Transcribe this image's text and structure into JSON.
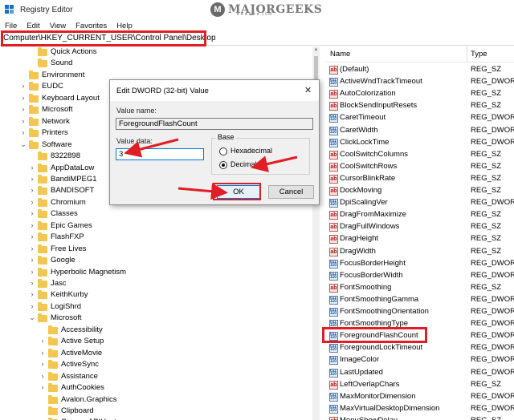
{
  "window": {
    "title": "Registry Editor"
  },
  "watermark": {
    "logo": "M",
    "text": "MAJORGEEKS",
    "suffix": ".COM",
    "stars": "★★★★★★.COM"
  },
  "menu": [
    "File",
    "Edit",
    "View",
    "Favorites",
    "Help"
  ],
  "address": "Computer\\HKEY_CURRENT_USER\\Control Panel\\Desktop",
  "tree": [
    {
      "label": "Quick Actions",
      "expander": "",
      "level": 3
    },
    {
      "label": "Sound",
      "expander": "",
      "level": 3
    },
    {
      "label": "Environment",
      "expander": "",
      "level": 2
    },
    {
      "label": "EUDC",
      "expander": "›",
      "level": 2
    },
    {
      "label": "Keyboard Layout",
      "expander": "›",
      "level": 2
    },
    {
      "label": "Microsoft",
      "expander": "›",
      "level": 2
    },
    {
      "label": "Network",
      "expander": "›",
      "level": 2
    },
    {
      "label": "Printers",
      "expander": "›",
      "level": 2
    },
    {
      "label": "Software",
      "expander": "⌄",
      "level": 2
    },
    {
      "label": "8322898",
      "expander": "",
      "level": 3
    },
    {
      "label": "AppDataLow",
      "expander": "›",
      "level": 3
    },
    {
      "label": "BandiMPEG1",
      "expander": "›",
      "level": 3
    },
    {
      "label": "BANDISOFT",
      "expander": "›",
      "level": 3
    },
    {
      "label": "Chromium",
      "expander": "›",
      "level": 3
    },
    {
      "label": "Classes",
      "expander": "›",
      "level": 3
    },
    {
      "label": "Epic Games",
      "expander": "›",
      "level": 3
    },
    {
      "label": "FlashFXP",
      "expander": "›",
      "level": 3
    },
    {
      "label": "Free Lives",
      "expander": "›",
      "level": 3
    },
    {
      "label": "Google",
      "expander": "›",
      "level": 3
    },
    {
      "label": "Hyperbolic Magnetism",
      "expander": "›",
      "level": 3
    },
    {
      "label": "Jasc",
      "expander": "›",
      "level": 3
    },
    {
      "label": "KeithKurby",
      "expander": "›",
      "level": 3
    },
    {
      "label": "LogiShrd",
      "expander": "›",
      "level": 3
    },
    {
      "label": "Microsoft",
      "expander": "⌄",
      "level": 3
    },
    {
      "label": "Accessibility",
      "expander": "",
      "level": 4
    },
    {
      "label": "Active Setup",
      "expander": "›",
      "level": 4
    },
    {
      "label": "ActiveMovie",
      "expander": "›",
      "level": 4
    },
    {
      "label": "ActiveSync",
      "expander": "›",
      "level": 4
    },
    {
      "label": "Assistance",
      "expander": "›",
      "level": 4
    },
    {
      "label": "AuthCookies",
      "expander": "›",
      "level": 4
    },
    {
      "label": "Avalon.Graphics",
      "expander": "",
      "level": 4
    },
    {
      "label": "Clipboard",
      "expander": "",
      "level": 4
    },
    {
      "label": "CameraAPIHost",
      "expander": "",
      "level": 4
    }
  ],
  "list": {
    "col_name": "Name",
    "col_type": "Type",
    "rows": [
      {
        "name": "(Default)",
        "type": "REG_SZ",
        "icon": "ab"
      },
      {
        "name": "ActiveWndTrackTimeout",
        "type": "REG_DWORD",
        "icon": "bin"
      },
      {
        "name": "AutoColorization",
        "type": "REG_SZ",
        "icon": "ab"
      },
      {
        "name": "BlockSendInputResets",
        "type": "REG_SZ",
        "icon": "ab"
      },
      {
        "name": "CaretTimeout",
        "type": "REG_DWORD",
        "icon": "bin"
      },
      {
        "name": "CaretWidth",
        "type": "REG_DWORD",
        "icon": "bin"
      },
      {
        "name": "ClickLockTime",
        "type": "REG_DWORD",
        "icon": "bin"
      },
      {
        "name": "CoolSwitchColumns",
        "type": "REG_SZ",
        "icon": "ab"
      },
      {
        "name": "CoolSwitchRows",
        "type": "REG_SZ",
        "icon": "ab"
      },
      {
        "name": "CursorBlinkRate",
        "type": "REG_SZ",
        "icon": "ab"
      },
      {
        "name": "DockMoving",
        "type": "REG_SZ",
        "icon": "ab"
      },
      {
        "name": "DpiScalingVer",
        "type": "REG_DWORD",
        "icon": "bin"
      },
      {
        "name": "DragFromMaximize",
        "type": "REG_SZ",
        "icon": "ab"
      },
      {
        "name": "DragFullWindows",
        "type": "REG_SZ",
        "icon": "ab"
      },
      {
        "name": "DragHeight",
        "type": "REG_SZ",
        "icon": "ab"
      },
      {
        "name": "DragWidth",
        "type": "REG_SZ",
        "icon": "ab"
      },
      {
        "name": "FocusBorderHeight",
        "type": "REG_DWORD",
        "icon": "bin"
      },
      {
        "name": "FocusBorderWidth",
        "type": "REG_DWORD",
        "icon": "bin"
      },
      {
        "name": "FontSmoothing",
        "type": "REG_SZ",
        "icon": "ab"
      },
      {
        "name": "FontSmoothingGamma",
        "type": "REG_DWORD",
        "icon": "bin"
      },
      {
        "name": "FontSmoothingOrientation",
        "type": "REG_DWORD",
        "icon": "bin"
      },
      {
        "name": "FontSmoothingType",
        "type": "REG_DWORD",
        "icon": "bin"
      },
      {
        "name": "ForegroundFlashCount",
        "type": "REG_DWORD",
        "icon": "bin"
      },
      {
        "name": "ForegroundLockTimeout",
        "type": "REG_DWORD",
        "icon": "bin"
      },
      {
        "name": "ImageColor",
        "type": "REG_DWORD",
        "icon": "bin"
      },
      {
        "name": "LastUpdated",
        "type": "REG_DWORD",
        "icon": "bin"
      },
      {
        "name": "LeftOverlapChars",
        "type": "REG_SZ",
        "icon": "ab"
      },
      {
        "name": "MaxMonitorDimension",
        "type": "REG_DWORD",
        "icon": "bin"
      },
      {
        "name": "MaxVirtualDesktopDimension",
        "type": "REG_DWORD",
        "icon": "bin"
      },
      {
        "name": "MenuShowDelay",
        "type": "REG_SZ",
        "icon": "ab"
      }
    ]
  },
  "dialog": {
    "title": "Edit DWORD (32-bit) Value",
    "close": "✕",
    "value_name_label": "Value name:",
    "value_name": "ForegroundFlashCount",
    "value_data_label": "Value data:",
    "value_data": "3",
    "base_label": "Base",
    "hex_label": "Hexadecimal",
    "dec_label": "Decimal",
    "ok": "OK",
    "cancel": "Cancel"
  },
  "colors": {
    "highlight": "#e01e24",
    "folder": "#f3c650",
    "accent": "#0078d7"
  }
}
